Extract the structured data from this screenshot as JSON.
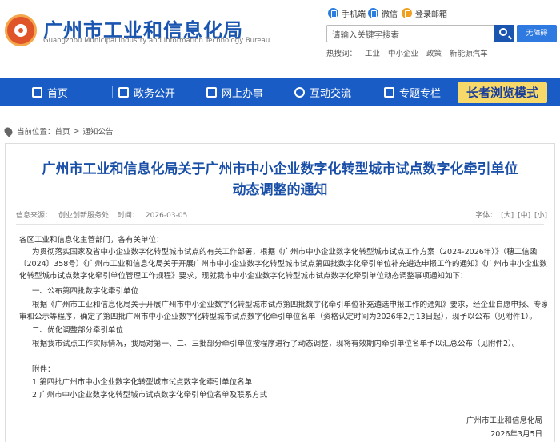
{
  "header": {
    "site_title": "广州市工业和信息化局",
    "site_subtitle": "Guangzhou Municipal Industry and Information Technology Bureau",
    "quick_links": {
      "mobile": "手机端",
      "wechat": "微信",
      "mail": "登录邮箱"
    },
    "search_placeholder": "请输入关键字搜索",
    "accessible_label": "无障碍",
    "hot_label": "热搜词：",
    "hot_words": [
      "工业",
      "中小企业",
      "政策",
      "新能源汽车"
    ]
  },
  "nav": {
    "items": [
      "首页",
      "政务公开",
      "网上办事",
      "互动交流",
      "专题专栏"
    ],
    "elder_mode": "长者浏览模式"
  },
  "breadcrumb": {
    "label": "当前位置：",
    "home": "首页",
    "sep": ">",
    "current": "通知公告"
  },
  "article": {
    "title_line1": "广州市工业和信息化局关于广州市中小企业数字化转型城市试点数字化牵引单位",
    "title_line2": "动态调整的通知",
    "source_label": "信息来源：",
    "source": "创业创新服务处",
    "time_label": "时间：",
    "time": "2026-03-05",
    "font_label": "字体：",
    "font_sizes": [
      "[大]",
      "[中]",
      "[小]"
    ],
    "paragraphs": [
      "各区工业和信息化主管部门，各有关单位：",
      "为贯彻落实国家及省中小企业数字化转型城市试点的有关工作部署，根据《广州市中小企业数字化转型城市试点工作方案（2024-2026年）》（穗工信函",
      "〔2024〕358号）《广州市工业和信息化局关于开展广州市中小企业数字化转型城市试点第四批数字化牵引单位补充遴选申报工作的通知》《广州市中小企业数字",
      "化转型城市试点数字化牵引单位管理工作规程》要求，现就我市中小企业数字化转型城市试点数字化牵引单位动态调整事项通知如下：",
      "一、公布第四批数字化牵引单位",
      "根据《广州市工业和信息化局关于开展广州市中小企业数字化转型城市试点第四批数字化牵引单位补充遴选申报工作的通知》要求，经企业自愿申报、专家评",
      "审和公示等程序，确定了第四批广州市中小企业数字化转型城市试点数字化牵引单位名单（资格认定时间为2026年2月13日起），现予以公布（见附件1）。",
      "二、优化调整部分牵引单位",
      "根据我市试点工作实际情况，我局对第一、二、三批部分牵引单位按程序进行了动态调整，现将有效期内牵引单位名单予以汇总公布（见附件2）。",
      "附件：",
      "1.第四批广州市中小企业数字化转型城市试点数字化牵引单位名单",
      "2.广州市中小企业数字化转型城市试点数字化牵引单位名单及联系方式"
    ],
    "signature": "广州市工业和信息化局",
    "sign_date": "2026年3月5日"
  }
}
